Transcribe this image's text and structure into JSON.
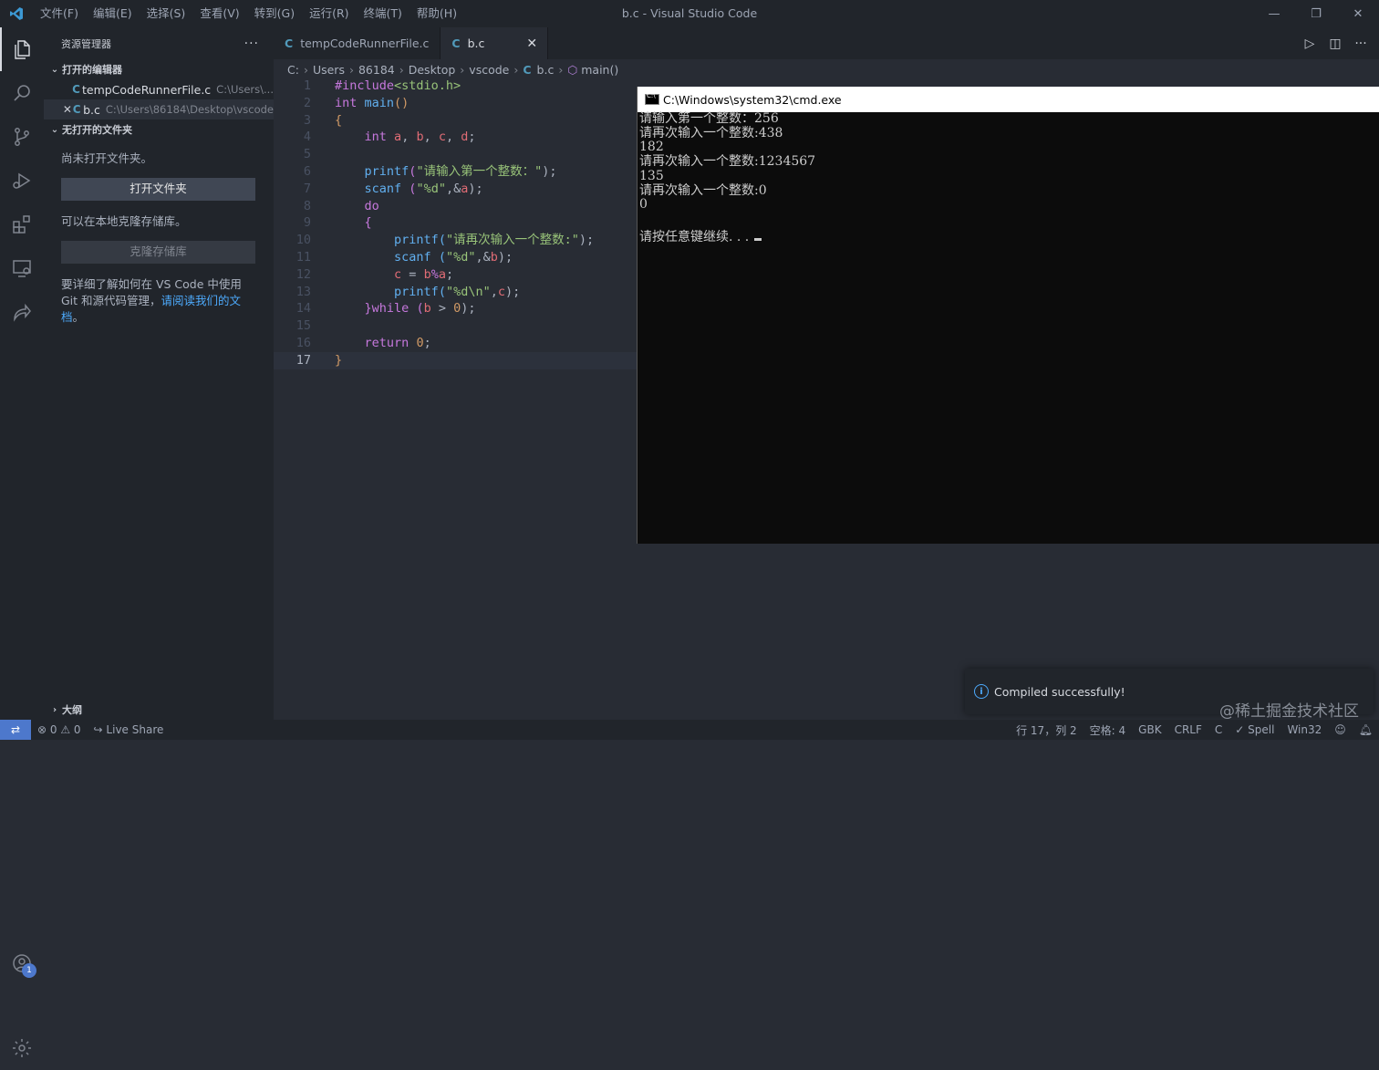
{
  "titlebar": {
    "menu": [
      "文件(F)",
      "编辑(E)",
      "选择(S)",
      "查看(V)",
      "转到(G)",
      "运行(R)",
      "终端(T)",
      "帮助(H)"
    ],
    "window_title": "b.c - Visual Studio Code"
  },
  "activity_bar": {
    "items": [
      "files-icon",
      "search-icon",
      "source-control-icon",
      "run-debug-icon",
      "extensions-icon",
      "remote-explorer-icon",
      "live-share-icon"
    ],
    "accounts_badge": "1"
  },
  "sidebar": {
    "title": "资源管理器",
    "more": "···",
    "open_editors_header": "打开的编辑器",
    "open_editors": [
      {
        "icon": "C",
        "name": "tempCodeRunnerFile.c",
        "path": "C:\\Users\\..."
      },
      {
        "icon": "C",
        "name": "b.c",
        "path": "C:\\Users\\86184\\Desktop\\vscode"
      }
    ],
    "no_folder_header": "无打开的文件夹",
    "no_folder_text": "尚未打开文件夹。",
    "open_folder_button": "打开文件夹",
    "clone_text": "可以在本地克隆存储库。",
    "clone_button": "克隆存储库",
    "learn_text": "要详细了解如何在 VS Code 中使用 Git 和源代码管理，",
    "learn_link": "请阅读我们的文档",
    "learn_end": "。",
    "outline_header": "大纲"
  },
  "tabs": [
    {
      "icon": "C",
      "label": "tempCodeRunnerFile.c"
    },
    {
      "icon": "C",
      "label": "b.c",
      "close": "✕"
    }
  ],
  "breadcrumb": {
    "parts": [
      "C:",
      "Users",
      "86184",
      "Desktop",
      "vscode"
    ],
    "file_icon": "C",
    "file": "b.c",
    "symbol": "main()"
  },
  "code": {
    "line_numbers": [
      "1",
      "2",
      "3",
      "4",
      "5",
      "6",
      "7",
      "8",
      "9",
      "10",
      "11",
      "12",
      "13",
      "14",
      "15",
      "16",
      "17"
    ],
    "current_line": "17",
    "l1a": "#include",
    "l1b": "<stdio.h>",
    "l2a": "int",
    "l2b": "main",
    "l2c": "()",
    "l3": "{",
    "l4a": "int",
    "l4b": "a",
    "l4c": "b",
    "l4d": "c",
    "l4e": "d",
    "l6a": "printf",
    "l6b": "(",
    "l6c": "\"请输入第一个整数：\"",
    "l6d": ");",
    "l7a": "scanf",
    "l7b": "(",
    "l7c": "\"%d\"",
    "l7d": ",&",
    "l7e": "a",
    "l7f": ");",
    "l8": "do",
    "l9": "{",
    "l10a": "printf",
    "l10b": "(",
    "l10c": "\"请再次输入一个整数:\"",
    "l10d": ");",
    "l11a": "scanf",
    "l11b": "(",
    "l11c": "\"%d\"",
    "l11d": ",&",
    "l11e": "b",
    "l11f": ");",
    "l12a": "c",
    "l12b": " = ",
    "l12c": "b",
    "l12d": "%",
    "l12e": "a",
    "l12f": ";",
    "l13a": "printf",
    "l13b": "(",
    "l13c": "\"%d\\n\"",
    "l13d": ",",
    "l13e": "c",
    "l13f": ");",
    "l14a": "}",
    "l14b": "while",
    "l14c": "(",
    "l14d": "b",
    "l14e": " > ",
    "l14f": "0",
    "l14g": ");",
    "l16a": "return",
    "l16b": "0",
    "l16c": ";",
    "l17": "}"
  },
  "cmd": {
    "title": "C:\\Windows\\system32\\cmd.exe",
    "lines": [
      "请输入第一个整数：256",
      "请再次输入一个整数:438",
      "182",
      "请再次输入一个整数:1234567",
      "135",
      "请再次输入一个整数:0",
      "0",
      "",
      "请按任意键继续. . ."
    ]
  },
  "notification": {
    "text": "Compiled successfully!"
  },
  "watermark": "@稀土掘金技术社区",
  "statusbar": {
    "errors": "0",
    "warnings": "0",
    "live_share": "Live Share",
    "position": "行 17，列 2",
    "spaces": "空格: 4",
    "encoding": "GBK",
    "eol": "CRLF",
    "language": "C",
    "spell": "Spell",
    "platform": "Win32"
  },
  "colors": {
    "accent": "#4d78cc",
    "link": "#4daafc",
    "c_icon": "#519aba"
  }
}
